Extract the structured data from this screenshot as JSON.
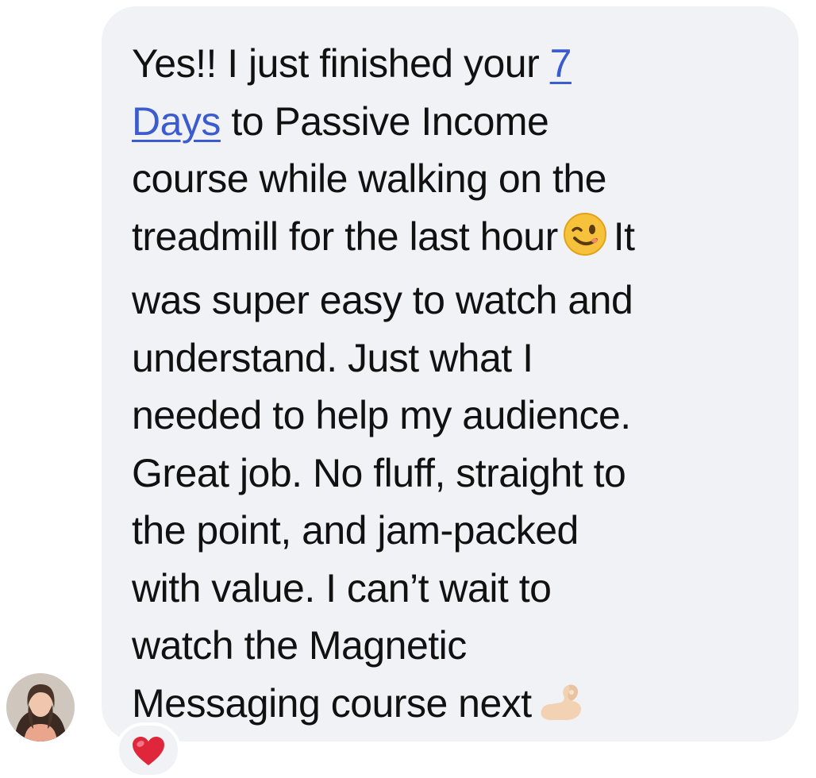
{
  "message": {
    "lines": [
      {
        "before": "Yes!! I just finished your ",
        "link": "7"
      },
      {
        "link": "Days",
        "after": " to Passive Income"
      },
      {
        "text": "course while walking on the"
      },
      {
        "before": "treadmill for the last hour",
        "emoji": "winking-face",
        "after": "It"
      },
      {
        "text": "was super easy to watch and"
      },
      {
        "text": "understand. Just what I"
      },
      {
        "text": "needed to help my audience."
      },
      {
        "text": "Great job. No fluff, straight to"
      },
      {
        "text": "the point, and jam-packed"
      },
      {
        "text": "with value. I can’t wait to"
      },
      {
        "text": "watch the Magnetic"
      },
      {
        "before": "Messaging course next",
        "emoji": "ok-hand"
      }
    ]
  },
  "reaction": {
    "emoji": "red-heart"
  },
  "colors": {
    "bubble_background": "#f1f2f5",
    "text": "#111111",
    "link": "#3b5ccf",
    "heart": "#e0263a"
  }
}
